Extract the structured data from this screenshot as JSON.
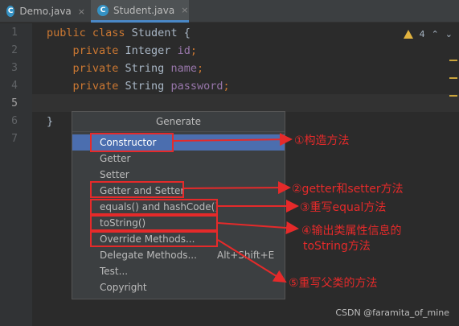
{
  "tabs": [
    {
      "label": "Demo.java",
      "icon": "java-class-icon",
      "active": false
    },
    {
      "label": "Student.java",
      "icon": "java-class-icon",
      "active": true
    }
  ],
  "tab_close_glyph": "×",
  "editor": {
    "line_numbers": [
      "1",
      "2",
      "3",
      "4",
      "5",
      "6",
      "7"
    ],
    "lines": [
      {
        "kw": "public class ",
        "rest": "Student {"
      },
      {
        "indent": "    ",
        "kw": "private ",
        "type": "Integer ",
        "field": "id",
        "end": ";"
      },
      {
        "indent": "    ",
        "kw": "private ",
        "type": "String ",
        "field": "name",
        "end": ";"
      },
      {
        "indent": "    ",
        "kw": "private ",
        "type": "String ",
        "field": "password",
        "end": ";"
      },
      {
        "text": ""
      },
      {
        "text": "}"
      },
      {
        "text": ""
      }
    ],
    "warning_count": "4",
    "colors": {
      "keyword": "#cc7832",
      "field": "#9876aa",
      "text": "#a9b7c6"
    }
  },
  "popup": {
    "title": "Generate",
    "items": [
      {
        "label": "Constructor",
        "selected": true
      },
      {
        "label": "Getter"
      },
      {
        "label": "Setter"
      },
      {
        "label": "Getter and Setter"
      },
      {
        "label": "equals() and hashCode()"
      },
      {
        "label": "toString()"
      },
      {
        "label": "Override Methods..."
      },
      {
        "label": "Delegate Methods...",
        "shortcut": "Alt+Shift+E"
      },
      {
        "label": "Test..."
      },
      {
        "label": "Copyright"
      }
    ]
  },
  "annotations": [
    "①构造方法",
    "②getter和setter方法",
    "③重写equal方法",
    "④输出类属性信息的",
    "toString方法",
    "⑤重写父类的方法"
  ],
  "watermark": "CSDN @faramita_of_mine",
  "accent_color": "#e52a2a"
}
